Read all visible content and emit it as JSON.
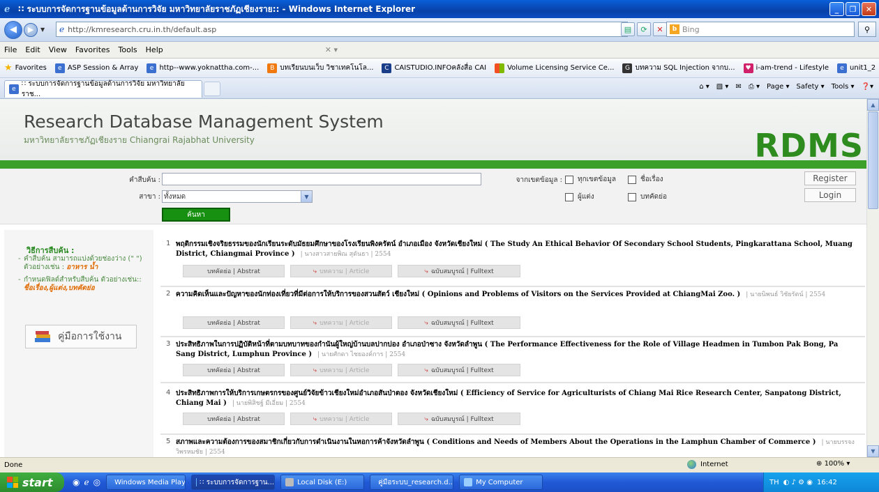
{
  "window": {
    "title": "∷ ระบบการจัดการฐานข้อมูลด้านการวิจัย มหาวิทยาลัยราชภัฏเชียงราย:: - Windows Internet Explorer"
  },
  "nav": {
    "address": "http://kmresearch.cru.in.th/default.asp",
    "search_engine": "Bing"
  },
  "menu": [
    "File",
    "Edit",
    "View",
    "Favorites",
    "Tools",
    "Help"
  ],
  "favorites": {
    "label": "Favorites",
    "items": [
      "ASP Session & Array",
      "http--www.yoknattha.com-...",
      "บทเรียนบนเว็บ วิชาเทคโนโล...",
      "CAISTUDIO.INFOคลังสื่อ CAI",
      "Volume Licensing Service Ce...",
      "บทความ SQL Injection จากบ...",
      "i-am-trend - Lifestyle",
      "unit1_2"
    ]
  },
  "tab": {
    "title": "∷ ระบบการจัดการฐานข้อมูลด้านการวิจัย มหาวิทยาลัยราช..."
  },
  "command_bar": {
    "page": "Page",
    "safety": "Safety",
    "tools": "Tools"
  },
  "site": {
    "title": "Research Database Management System",
    "subtitle": "มหาวิทยาลัยราชภัฏเชียงราย Chiangrai Rajabhat University",
    "logo": "RDMS"
  },
  "search": {
    "keyword_label": "คำสืบค้น :",
    "branch_label": "สาขา :",
    "branch_value": "ทั้งหมด",
    "button": "ค้นหา",
    "scope_label": "จากเขตข้อมูล :",
    "opt_all": "ทุกเขตข้อมูล",
    "opt_title": "ชื่อเรื่อง",
    "opt_author": "ผู้แต่ง",
    "opt_abstract": "บทคัดย่อ",
    "register": "Register",
    "login": "Login"
  },
  "sidebar": {
    "heading": "วิธีการสืบค้น :",
    "tip1_text": "คำสืบค้น สามารถแบ่งด้วยช่องว่าง (\" \") ตัวอย่างเช่น :",
    "tip1_example": "อาหาร น้ำ",
    "tip2_text": "กำหนดฟิลด์สำหรับสืบค้น ตัวอย่างเช่น::",
    "tip2_example": "ชื่อเรื่อง,ผู้แต่ง,บทคัดย่อ",
    "manual": "คู่มือการใช้งาน"
  },
  "result_buttons": {
    "abstract": "บทคัดย่อ | Abstrat",
    "article": "บทความ | Article",
    "fulltext": "ฉบับสมบูรณ์ | Fulltext"
  },
  "results": [
    {
      "num": "1",
      "title": "พฤติกรรมเชิงจริยธรรมของนักเรียนระดับมัธยมศึกษาของโรงเรียนพิงครัตน์ อำเภอเมือง จังหวัดเชียงใหม่ ( The Study An Ethical Behavior Of Secondary School Students, Pingkarattana School, Muang District, Chiangmai Province )",
      "meta": "| นางสาวสายพิณ สุดันธา | 2554"
    },
    {
      "num": "2",
      "title": "ความคิดเห็นและปัญหาของนักท่องเที่ยวที่มีต่อการให้บริการของสวนสัตว์ เชียงใหม่ ( Opinions and Problems of Visitors on the Services Provided at ChiangMai Zoo. )",
      "meta": "| นายนิพนธ์ วิชัยรัตน์ | 2554"
    },
    {
      "num": "3",
      "title": "ประสิทธิภาพในการปฏิบัติหน้าที่ตามบทบาทของกำนันผู้ใหญ่บ้านบลปากบ่อง อำเภอป่าซาง จังหวัดลำพูน ( The Performance Effectiveness for the Role of Village Headmen in Tumbon Pak Bong, Pa Sang District, Lumphun Province )",
      "meta": "| นายศักดา ไชยองค์การ | 2554"
    },
    {
      "num": "4",
      "title": "ประสิทธิภาพการให้บริการเกษตรกรของศูนย์วิจัยข้าวเชียงใหม่อำเภอสันป่าตอง จังหวัดเชียงใหม่ ( Efficiency of Service for Agriculturists of Chiang Mai Rice Research Center, Sanpatong District, Chiang Mai )",
      "meta": "| นายพิสิชฐ์ มีเอี่ยม | 2554"
    },
    {
      "num": "5",
      "title": "สภาพและความต้องการของสมาชิกเกี่ยวกับการดำเนินงานในหอการค้าจังหวัดลำพูน ( Conditions and Needs of Members About the Operations in the Lamphun Chamber of Commerce )",
      "meta": "| นายบรรจง วิพรหมชัย | 2554"
    }
  ],
  "status": {
    "text": "Done",
    "zone": "Internet",
    "zoom": "100%"
  },
  "taskbar": {
    "start": "start",
    "tasks": [
      "Windows Media Player",
      "∷ ระบบการจัดการฐาน...",
      "Local Disk (E:)",
      "คู่มือระบบ_research.d...",
      "My Computer"
    ],
    "lang": "TH",
    "clock": "16:42"
  }
}
